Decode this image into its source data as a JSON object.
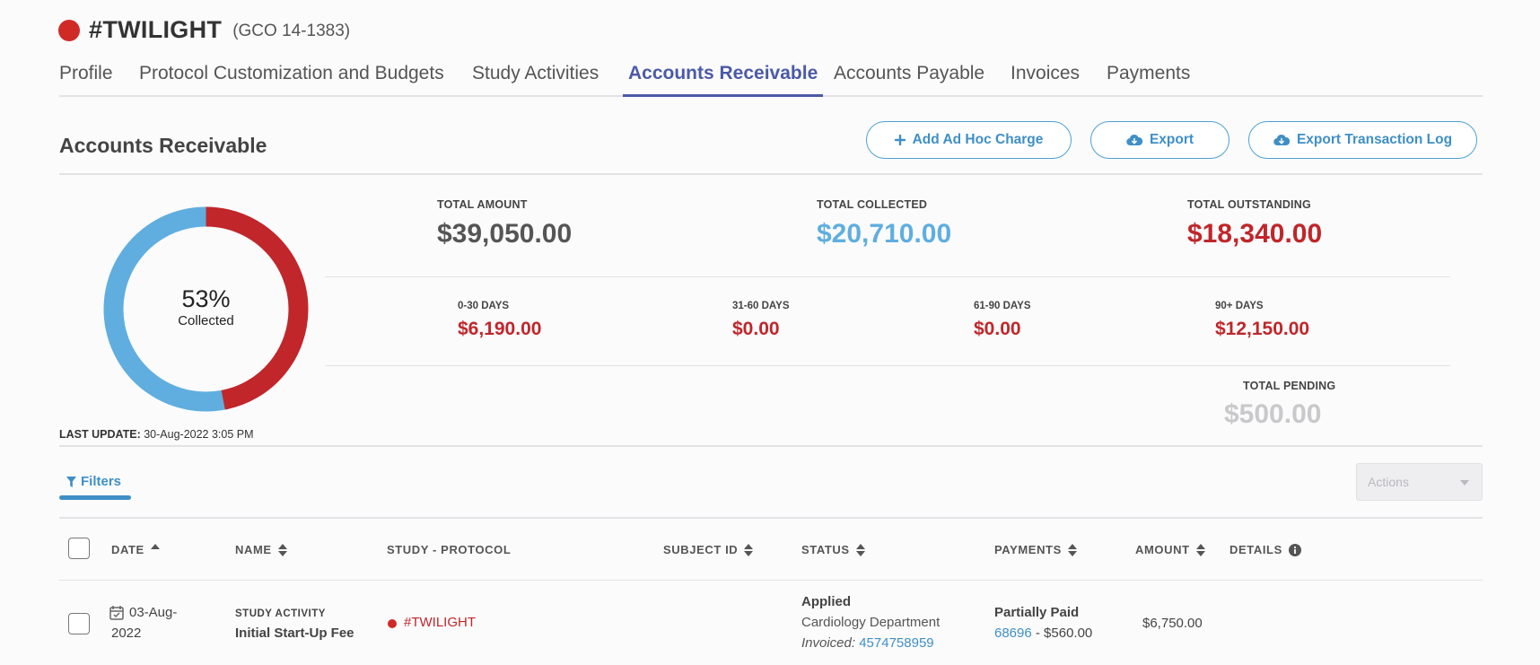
{
  "header": {
    "study_name": "#TWILIGHT",
    "study_code": "(GCO 14-1383)",
    "dot_color": "#d02a26"
  },
  "tabs": [
    {
      "label": "Profile",
      "active": false
    },
    {
      "label": "Protocol Customization and Budgets",
      "active": false
    },
    {
      "label": "Study Activities",
      "active": false
    },
    {
      "label": "Accounts Receivable",
      "active": true
    },
    {
      "label": "Accounts Payable",
      "active": false
    },
    {
      "label": "Invoices",
      "active": false
    },
    {
      "label": "Payments",
      "active": false
    }
  ],
  "section": {
    "title": "Accounts Receivable",
    "buttons": {
      "add_charge": "Add Ad Hoc Charge",
      "export": "Export",
      "export_log": "Export Transaction Log"
    }
  },
  "summary": {
    "collected_fraction": 0.53,
    "percent_text": "53%",
    "collected_label": "Collected",
    "last_update_label": "LAST UPDATE:",
    "last_update_value": "30-Aug-2022 3:05 PM",
    "total_amount_label": "TOTAL AMOUNT",
    "total_amount": "$39,050.00",
    "total_collected_label": "TOTAL COLLECTED",
    "total_collected": "$20,710.00",
    "total_outstanding_label": "TOTAL OUTSTANDING",
    "total_outstanding": "$18,340.00",
    "aging": [
      {
        "label": "0-30 DAYS",
        "value": "$6,190.00"
      },
      {
        "label": "31-60 DAYS",
        "value": "$0.00"
      },
      {
        "label": "61-90 DAYS",
        "value": "$0.00"
      },
      {
        "label": "90+ DAYS",
        "value": "$12,150.00"
      }
    ],
    "total_pending_label": "TOTAL PENDING",
    "total_pending": "$500.00",
    "colors": {
      "collected": "#5faedf",
      "outstanding": "#c0262a",
      "neutral": "#555555",
      "pending": "#c9c9cc"
    }
  },
  "toolbar": {
    "filters_label": "Filters",
    "actions_label": "Actions"
  },
  "table": {
    "columns": {
      "date": "DATE",
      "name": "NAME",
      "study_protocol": "STUDY - PROTOCOL",
      "subject_id": "SUBJECT ID",
      "status": "STATUS",
      "payments": "PAYMENTS",
      "amount": "AMOUNT",
      "details": "DETAILS"
    },
    "rows": [
      {
        "date_line1": "03-Aug-",
        "date_line2": "2022",
        "type": "STUDY ACTIVITY",
        "name": "Initial Start-Up Fee",
        "study": "#TWILIGHT",
        "subject_id": "",
        "status": "Applied",
        "department": "Cardiology Department",
        "invoiced_label": "Invoiced:",
        "invoice_number": "4574758959",
        "payment_status": "Partially Paid",
        "payment_ref": "68696",
        "payment_amount": "- $560.00",
        "amount": "$6,750.00"
      }
    ]
  }
}
